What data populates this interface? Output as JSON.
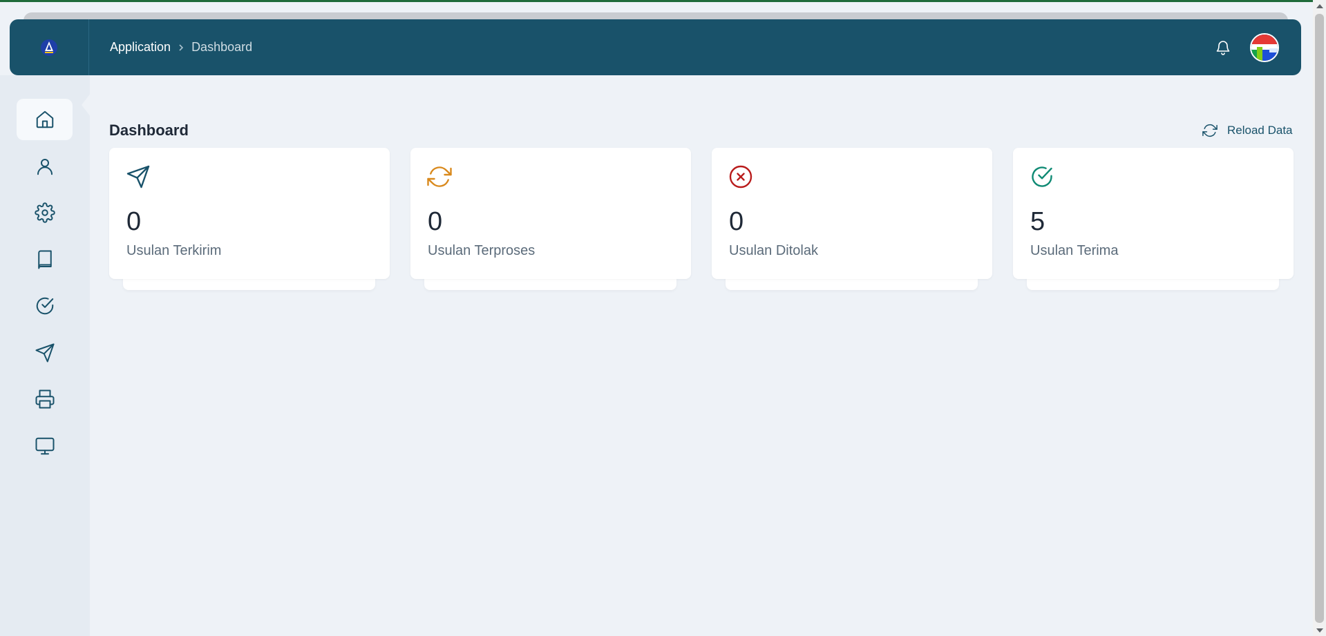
{
  "header": {
    "breadcrumb": {
      "app": "Application",
      "current": "Dashboard"
    }
  },
  "sidebar": {
    "items": [
      {
        "icon": "home-icon",
        "active": true
      },
      {
        "icon": "user-icon",
        "active": false
      },
      {
        "icon": "gear-icon",
        "active": false
      },
      {
        "icon": "book-icon",
        "active": false
      },
      {
        "icon": "check-circle-icon",
        "active": false
      },
      {
        "icon": "send-icon",
        "active": false
      },
      {
        "icon": "printer-icon",
        "active": false
      },
      {
        "icon": "monitor-icon",
        "active": false
      }
    ]
  },
  "main": {
    "title": "Dashboard",
    "reload_label": "Reload Data",
    "cards": [
      {
        "icon": "send-icon",
        "value": "0",
        "label": "Usulan Terkirim",
        "color": "#19526a"
      },
      {
        "icon": "refresh-icon",
        "value": "0",
        "label": "Usulan Terproses",
        "color": "#d9891c"
      },
      {
        "icon": "x-circle-icon",
        "value": "0",
        "label": "Usulan Ditolak",
        "color": "#b91c1c"
      },
      {
        "icon": "check-circle-icon",
        "value": "5",
        "label": "Usulan Terima",
        "color": "#0f8a74"
      }
    ]
  },
  "colors": {
    "header_bg": "#19526a",
    "sidebar_bg": "#e5ebf2",
    "page_bg": "#eef2f7"
  }
}
